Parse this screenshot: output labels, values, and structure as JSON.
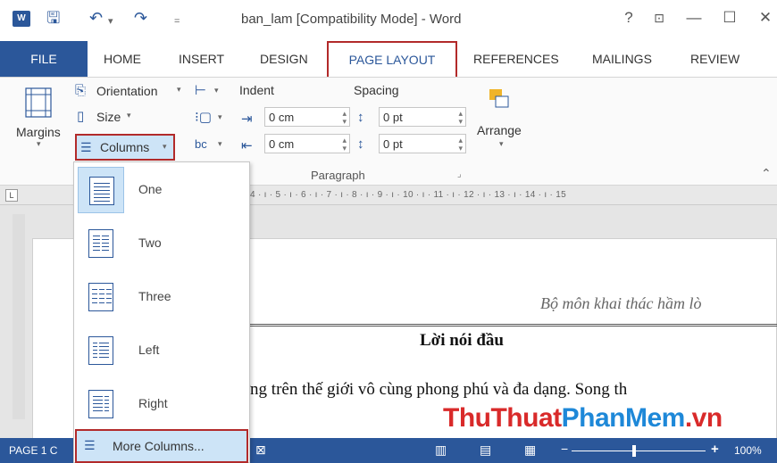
{
  "window": {
    "title": "ban_lam [Compatibility Mode] - Word",
    "app_icon": "W",
    "controls": {
      "help": "?",
      "restore_ribbon": "⊡",
      "minimize": "—",
      "maximize": "☐",
      "close": "✕"
    }
  },
  "quick_access": {
    "save": "🖫",
    "undo": "↶",
    "undo_dd": "▾",
    "redo": "↷",
    "customize": "="
  },
  "tabs": {
    "file": "FILE",
    "items": [
      "HOME",
      "INSERT",
      "DESIGN",
      "PAGE LAYOUT",
      "REFERENCES",
      "MAILINGS",
      "REVIEW"
    ],
    "active": "PAGE LAYOUT"
  },
  "ribbon": {
    "margins": "Margins",
    "orientation": "Orientation",
    "size": "Size",
    "columns": "Columns",
    "indent_label": "Indent",
    "spacing_label": "Spacing",
    "indent_left": "0 cm",
    "indent_right": "0 cm",
    "spacing_before": "0 pt",
    "spacing_after": "0 pt",
    "arrange": "Arrange",
    "paragraph_group": "Paragraph",
    "dropdown_arrow": "▾",
    "spin_up": "▴",
    "spin_down": "▾"
  },
  "ruler": {
    "marks": "4 · ı · 5 · ı · 6 · ı · 7 · ı · 8 · ı · 9 · ı · 10 · ı · 11 · ı · 12 · ı · 13 · ı · 14 · ı · 15",
    "corner": "L"
  },
  "document": {
    "header": "Bộ môn khai thác hầm lò",
    "title": "Lời nói đầu",
    "body_line": "ợng trên thế giới vô cùng phong phú và đa dạng. Song th",
    "watermark_red": "ThuThuat",
    "watermark_blue": "PhanMem",
    "watermark_suffix": ".vn"
  },
  "columns_menu": {
    "items": [
      {
        "label": "One",
        "cols": 1
      },
      {
        "label": "Two",
        "cols": 2
      },
      {
        "label": "Three",
        "cols": 3
      },
      {
        "label": "Left",
        "cols": 2
      },
      {
        "label": "Right",
        "cols": 2
      }
    ],
    "selected": "One",
    "more": "More Columns..."
  },
  "status": {
    "page": "PAGE 1 C",
    "zoom": "100%",
    "zoom_minus": "−",
    "zoom_plus": "+"
  },
  "colors": {
    "word_blue": "#2b579a",
    "highlight_red": "#b22a2a",
    "selected_fill": "#cde4f7"
  }
}
